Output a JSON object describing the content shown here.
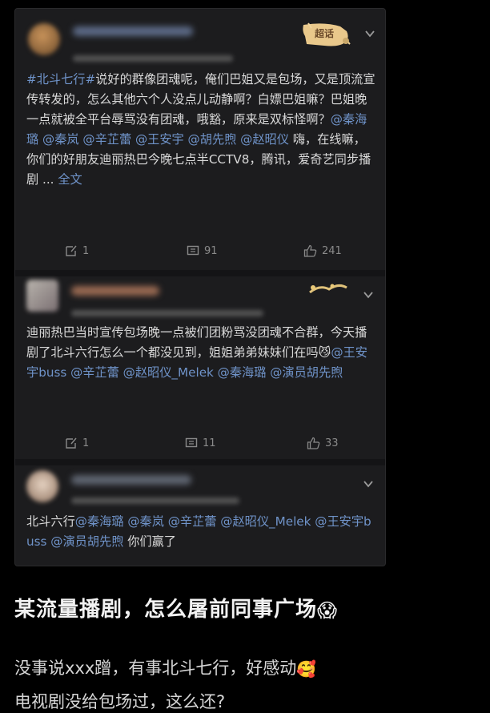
{
  "posts": [
    {
      "body_parts": [
        {
          "t": "#北斗七行#",
          "k": "tag"
        },
        {
          "t": "说好的群像团魂呢，俺们巴姐又是包场，又是顶流宣传转发的，怎么其他六个人没点儿动静啊？白嫖巴姐嘛？巴姐晚一点就被全平台辱骂没有团魂，哦豁，原来是双标怪啊？",
          "k": "plain"
        },
        {
          "t": "@秦海璐 @秦岚 @辛芷蕾 @王安宇 @胡先煦 @赵昭仪",
          "k": "at"
        },
        {
          "t": " 嗨，在线嘛，你们的好朋友迪丽热巴今晚七点半CCTV8，腾讯，爱奇艺同步播剧 ... ",
          "k": "plain"
        },
        {
          "t": "全文",
          "k": "at"
        }
      ],
      "repost": "1",
      "comments": "91",
      "likes": "241",
      "badge_text": "超话"
    },
    {
      "body_parts": [
        {
          "t": "迪丽热巴当时宣传包场晚一点被们团粉骂没团魂不合群，今天播剧了北斗六行怎么一个都没见到，姐姐弟弟妹妹们在吗",
          "k": "plain"
        },
        {
          "t": "😼",
          "k": "emoji"
        },
        {
          "t": "@王安宇buss @辛芷蕾 @赵昭仪_Melek @秦海璐 @演员胡先煦",
          "k": "at"
        }
      ],
      "repost": "1",
      "comments": "11",
      "likes": "33"
    },
    {
      "body_parts": [
        {
          "t": "北斗六行",
          "k": "plain"
        },
        {
          "t": "@秦海璐 @秦岚 @辛芷蕾 @赵昭仪_Melek @王安宇buss @演员胡先煦",
          "k": "at"
        },
        {
          "t": " 你们赢了",
          "k": "plain"
        }
      ]
    }
  ],
  "headline": "某流量播剧，怎么屠前同事广场",
  "headline_emoji": "😱",
  "caption1": "没事说xxx蹭，有事北斗七行，好感动",
  "caption1_emoji": "🥰",
  "caption2": "电视剧没给包场过，这么还?",
  "colors": {
    "link": "#6f93c9",
    "bg": "#000000",
    "card": "#1c1c1e"
  },
  "icons": [
    "chevron-down-icon",
    "repost-icon",
    "comment-icon",
    "like-icon"
  ]
}
